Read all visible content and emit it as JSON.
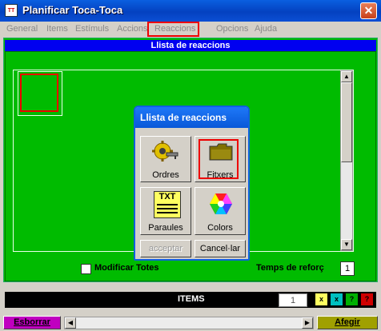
{
  "window": {
    "title": "Planificar Toca-Toca",
    "close_label": "✕"
  },
  "menu": {
    "items": [
      {
        "label": "General"
      },
      {
        "label": "Items"
      },
      {
        "label": "Estímuls"
      },
      {
        "label": "Accions"
      },
      {
        "label": "Reaccions"
      },
      {
        "label": "Opcions"
      },
      {
        "label": "Ajuda"
      }
    ],
    "highlighted": "Reaccions"
  },
  "list": {
    "header": "Llista de reaccions"
  },
  "dialog": {
    "title": "Llista de reaccions",
    "buttons": {
      "ordres": "Ordres",
      "fitxers": "Fitxers",
      "paraules": "Paraules",
      "paraules_icon_text": "TXT",
      "colors": "Colors",
      "acceptar": "acceptar",
      "cancel": "Cancel·lar"
    }
  },
  "options": {
    "modificar_totes": "Modificar Totes",
    "modificar_totes_checked": false,
    "temps_label": "Temps de reforç",
    "temps_value": "1"
  },
  "items_bar": {
    "label": "ITEMS",
    "count": "1",
    "squares": [
      {
        "text": "x",
        "color": "#ffff60"
      },
      {
        "text": "x",
        "color": "#00c0c0"
      },
      {
        "text": "?",
        "color": "#00b000"
      },
      {
        "text": "?",
        "color": "#d00000"
      }
    ]
  },
  "bottom": {
    "esborrar": "Esborrar",
    "afegir": "Afegir"
  },
  "colors": {
    "frame_green": "#00bb00",
    "header_blue": "#0000f0",
    "highlight_red": "#e00000"
  }
}
